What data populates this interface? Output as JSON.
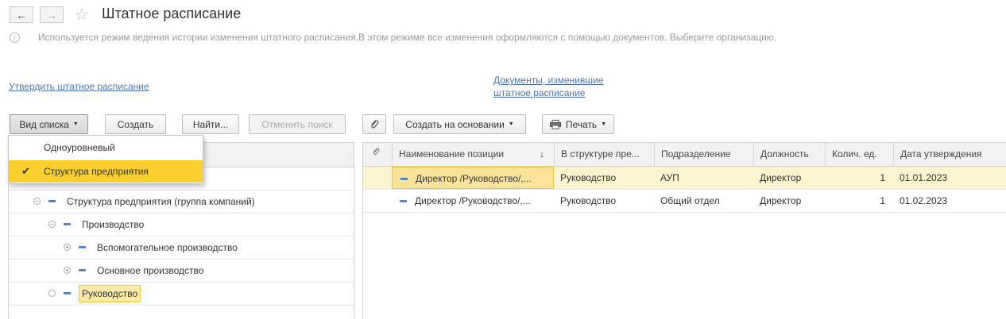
{
  "header": {
    "back_icon": "arrow-left-icon",
    "forward_icon": "arrow-right-icon",
    "favorite_icon": "star-icon",
    "title": "Штатное расписание"
  },
  "info": {
    "text": "Используется режим ведения истории изменения штатного расписания.В этом режиме все изменения оформляются с помощью документов. Выберите организацию."
  },
  "links": {
    "approve": "Утвердить штатное расписание",
    "docs_line1": "Документы, изменившие",
    "docs_line2": "штатное расписание"
  },
  "toolbar": {
    "view_list": "Вид списка",
    "create": "Создать",
    "find": "Найти...",
    "cancel_search": "Отменить поиск",
    "create_based_on": "Создать на основании",
    "print": "Печать"
  },
  "view_menu": {
    "items": [
      {
        "label": "Одноуровневый",
        "checked": false
      },
      {
        "label": "Структура предприятия",
        "checked": true
      }
    ]
  },
  "tree": {
    "items": [
      {
        "label": "Структура предприятия (группа компаний)"
      },
      {
        "label": "Производство"
      },
      {
        "label": "Вспомогательное производство"
      },
      {
        "label": "Основное производство"
      },
      {
        "label": "Руководство"
      }
    ]
  },
  "table": {
    "columns": [
      "Наименование позиции",
      "В структуре пре...",
      "Подразделение",
      "Должность",
      "Колич. ед.",
      "Дата утверждения"
    ],
    "sort_indicator": "↓",
    "rows": [
      {
        "name": "Директор /Руководство/,...",
        "structure": "Руководство",
        "department": "АУП",
        "position": "Директор",
        "count": "1",
        "date": "01.01.2023"
      },
      {
        "name": "Директор /Руководство/,...",
        "structure": "Руководство",
        "department": "Общий отдел",
        "position": "Директор",
        "count": "1",
        "date": "01.02.2023"
      }
    ]
  },
  "colors": {
    "accent_yellow": "#fbcf2d",
    "selection_row": "#fdf3d0",
    "link": "#4a76b8"
  }
}
